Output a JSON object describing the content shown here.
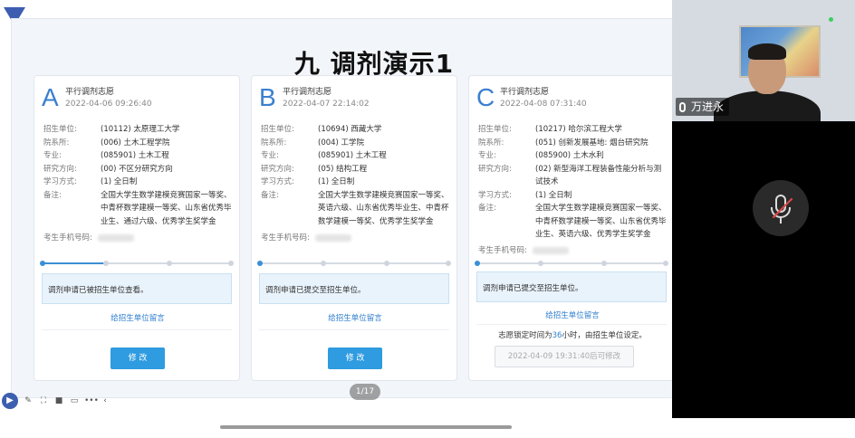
{
  "slide": {
    "title": "九  调剂演示1",
    "page_indicator": "1/17"
  },
  "labels": {
    "unit": "招生单位:",
    "dept": "院系所:",
    "major": "专业:",
    "direction": "研究方向:",
    "study": "学习方式:",
    "note": "备注:",
    "phone": "考生手机号码:",
    "message_link": "给招生单位留言",
    "edit_button": "修 改"
  },
  "cards": [
    {
      "letter": "A",
      "type": "平行调剂志愿",
      "date": "2022-04-06 09:26:40",
      "unit": "(10112) 太原理工大学",
      "dept": "(006) 土木工程学院",
      "major": "(085901) 土木工程",
      "direction": "(00) 不区分研究方向",
      "study": "(1) 全日制",
      "note": "全国大学生数学建模竞赛国家一等奖、中青杯数学建模一等奖、山东省优秀毕业生、通过六级、优秀学生奖学金",
      "progress": 0.33,
      "status": "调剂申请已被招生单位查看。"
    },
    {
      "letter": "B",
      "type": "平行调剂志愿",
      "date": "2022-04-07 22:14:02",
      "unit": "(10694) 西藏大学",
      "dept": "(004) 工学院",
      "major": "(085901) 土木工程",
      "direction": "(05) 结构工程",
      "study": "(1) 全日制",
      "note": "全国大学生数学建模竞赛国家一等奖、英语六级、山东省优秀毕业生、中青杯数学建模一等奖、优秀学生奖学金",
      "progress": 0.0,
      "status": "调剂申请已提交至招生单位。"
    },
    {
      "letter": "C",
      "type": "平行调剂志愿",
      "date": "2022-04-08 07:31:40",
      "unit": "(10217) 哈尔滨工程大学",
      "dept": "(051) 创新发展基地: 烟台研究院",
      "major": "(085900) 土木水利",
      "direction": "(02) 新型海洋工程装备性能分析与测试技术",
      "study": "(1) 全日制",
      "note": "全国大学生数学建模竞赛国家一等奖、中青杯数学建模一等奖、山东省优秀毕业生、英语六级、优秀学生奖学金",
      "progress": 0.0,
      "status": "调剂申请已提交至招生单位。",
      "lock_prefix": "志愿锁定时间为",
      "lock_hours": "36",
      "lock_suffix": "小时，由招生单位设定。",
      "lock_button": "2022-04-09 19:31:40后可修改"
    }
  ],
  "video": {
    "participant_name": "万进永"
  },
  "colors": {
    "accent": "#3b7fd0",
    "button": "#2f9be0",
    "status_bg": "#e9f3fb"
  }
}
